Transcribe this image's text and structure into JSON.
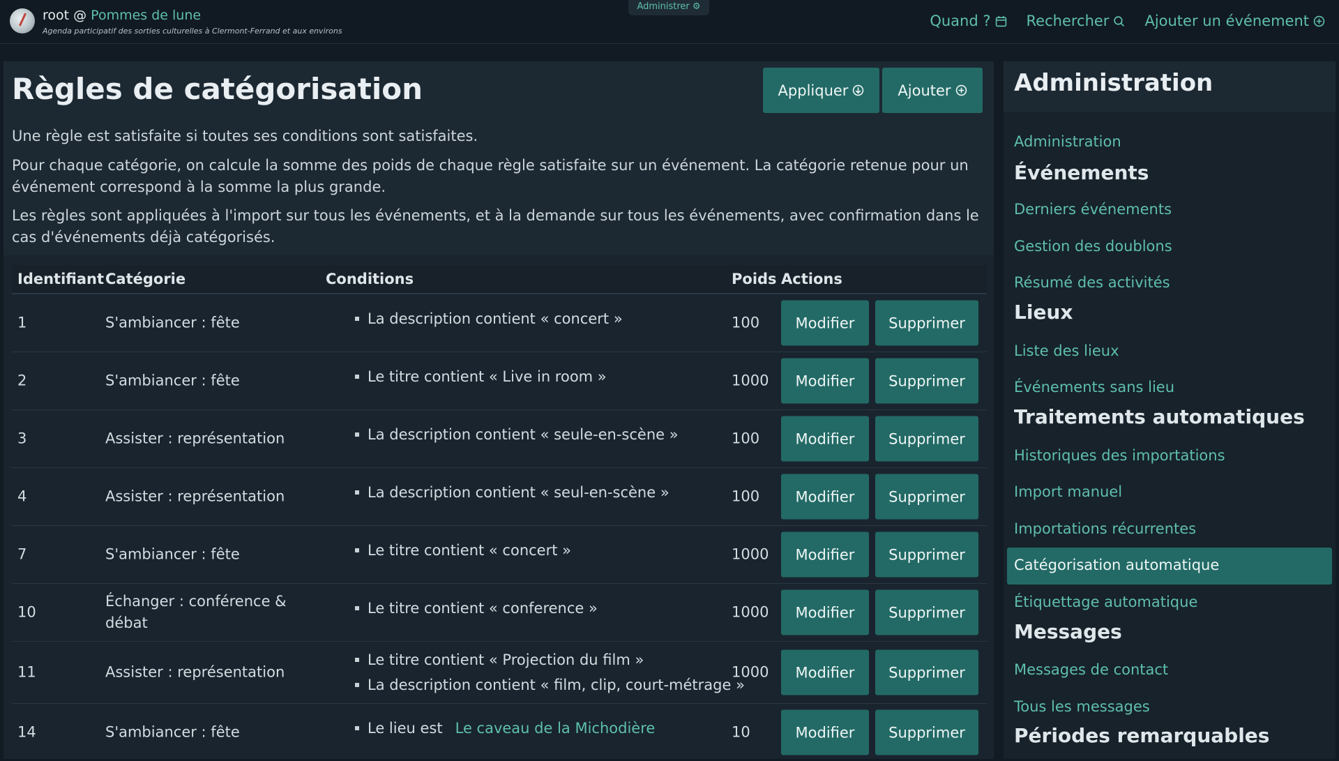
{
  "header": {
    "user": "root @ ",
    "site_name": "Pommes de lune",
    "tagline": "Agenda participatif des sorties culturelles à Clermont-Ferrand et aux environs",
    "admin_tab": "Administrer",
    "nav": {
      "when": "Quand ?",
      "search": "Rechercher",
      "add_event": "Ajouter un événement"
    }
  },
  "main": {
    "title": "Règles de catégorisation",
    "apply_label": "Appliquer",
    "add_label": "Ajouter",
    "descriptions": [
      "Une règle est satisfaite si toutes ses conditions sont satisfaites.",
      "Pour chaque catégorie, on calcule la somme des poids de chaque règle satisfaite sur un événement. La catégorie retenue pour un événement correspond à la somme la plus grande.",
      "Les règles sont appliquées à l'import sur tous les événements, et à la demande sur tous les événements, avec confirmation dans le cas d'événements déjà catégorisés."
    ]
  },
  "table": {
    "headers": [
      "Identifiant",
      "Catégorie",
      "Conditions",
      "Poids",
      "Actions"
    ],
    "modify_label": "Modifier",
    "delete_label": "Supprimer",
    "rows": [
      {
        "id": "1",
        "category": "S'ambiancer : fête",
        "conditions": [
          "La description contient « concert »"
        ],
        "weight": "100"
      },
      {
        "id": "2",
        "category": "S'ambiancer : fête",
        "conditions": [
          "Le titre contient « Live in room »"
        ],
        "weight": "1000"
      },
      {
        "id": "3",
        "category": "Assister : représentation",
        "conditions": [
          "La description contient « seule-en-scène »"
        ],
        "weight": "100"
      },
      {
        "id": "4",
        "category": "Assister : représentation",
        "conditions": [
          "La description contient « seul-en-scène »"
        ],
        "weight": "100"
      },
      {
        "id": "7",
        "category": "S'ambiancer : fête",
        "conditions": [
          "Le titre contient « concert »"
        ],
        "weight": "1000"
      },
      {
        "id": "10",
        "category": "Échanger : conférence & débat",
        "conditions": [
          "Le titre contient « conference »"
        ],
        "weight": "1000"
      },
      {
        "id": "11",
        "category": "Assister : représentation",
        "conditions": [
          "Le titre contient « Projection du film »",
          "La description contient « film, clip, court-métrage »"
        ],
        "weight": "1000"
      },
      {
        "id": "14",
        "category": "S'ambiancer : fête",
        "conditions_prefix": "Le lieu est ",
        "conditions_link": "Le caveau de la Michodière",
        "weight": "10"
      }
    ]
  },
  "sidebar": {
    "title": "Administration",
    "links": {
      "admin": "Administration",
      "latest": "Derniers événements",
      "duplicates": "Gestion des doublons",
      "activity": "Résumé des activités",
      "places_list": "Liste des lieux",
      "no_place": "Événements sans lieu",
      "imports_history": "Historiques des importations",
      "manual_import": "Import manuel",
      "recurring_imports": "Importations récurrentes",
      "auto_categorization": "Catégorisation automatique",
      "auto_tagging": "Étiquettage automatique",
      "contact_messages": "Messages de contact",
      "all_messages": "Tous les messages"
    },
    "sections": {
      "events": "Événements",
      "places": "Lieux",
      "auto": "Traitements automatiques",
      "messages": "Messages",
      "periods": "Périodes remarquables"
    }
  },
  "colors": {
    "accent": "#5fbfae",
    "button": "#236a66",
    "background": "#121b23"
  }
}
